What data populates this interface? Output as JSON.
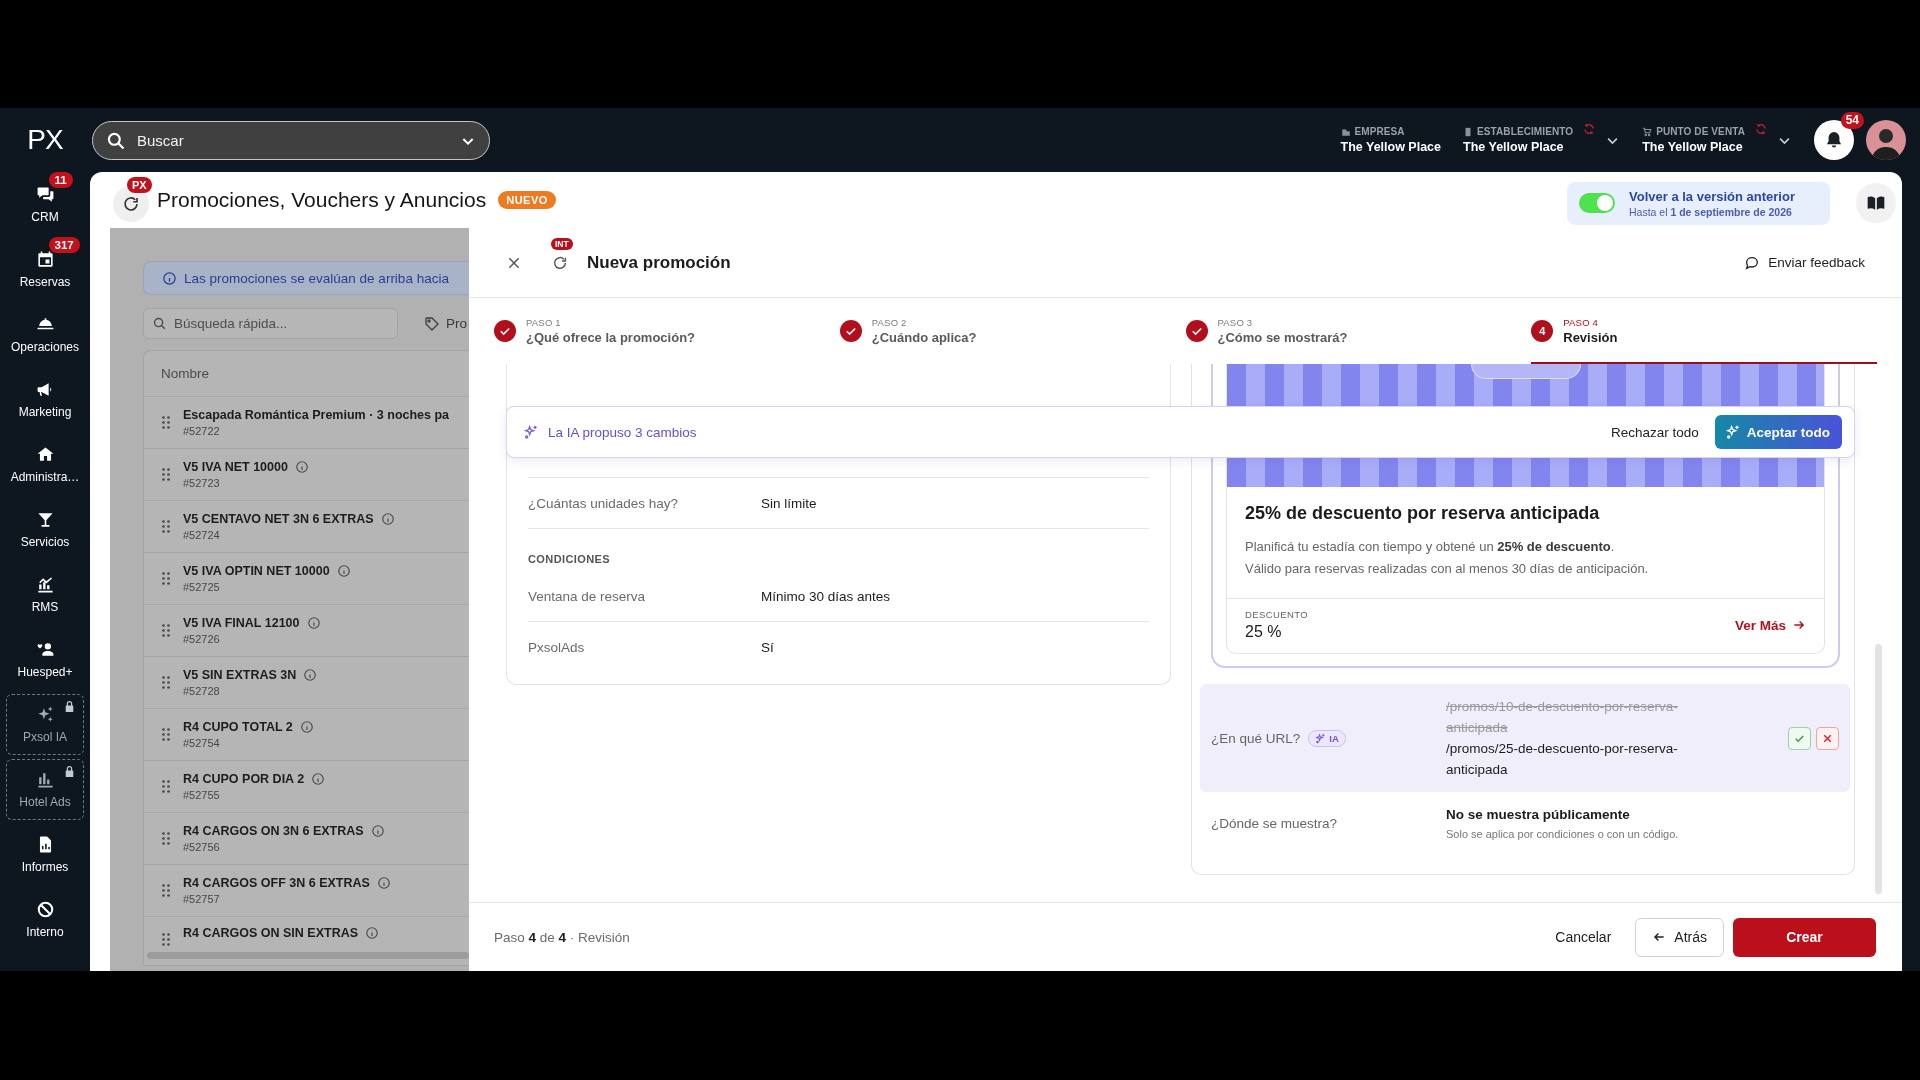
{
  "topbar": {
    "logo": "PX",
    "search": {
      "placeholder": "Buscar"
    },
    "context": [
      {
        "kind": "company",
        "label": "EMPRESA",
        "value": "The Yellow Place",
        "sync": false,
        "dropdown": false
      },
      {
        "kind": "property",
        "label": "ESTABLECIMIENTO",
        "value": "The Yellow Place",
        "sync": true,
        "dropdown": true
      },
      {
        "kind": "pos",
        "label": "PUNTO DE VENTA",
        "value": "The Yellow Place",
        "sync": true,
        "dropdown": true
      }
    ],
    "notifications": {
      "count": "54"
    }
  },
  "sidebar": {
    "items": [
      {
        "label": "CRM",
        "badge": "11",
        "locked": false,
        "selected": false
      },
      {
        "label": "Reservas",
        "badge": "317",
        "locked": false,
        "selected": false
      },
      {
        "label": "Operaciones",
        "locked": false,
        "selected": false
      },
      {
        "label": "Marketing",
        "locked": false,
        "selected": false
      },
      {
        "label": "Administra…",
        "locked": false,
        "selected": false
      },
      {
        "label": "Servicios",
        "locked": false,
        "selected": false
      },
      {
        "label": "RMS",
        "locked": false,
        "selected": false
      },
      {
        "label": "Huesped+",
        "locked": false,
        "selected": false
      },
      {
        "label": "Pxsol IA",
        "locked": true,
        "selected": false
      },
      {
        "label": "Hotel Ads",
        "locked": true,
        "selected": false
      },
      {
        "label": "Informes",
        "locked": false,
        "selected": false
      },
      {
        "label": "Interno",
        "locked": false,
        "selected": false
      }
    ]
  },
  "page": {
    "title": "Promociones, Vouchers y Anuncios",
    "badge": "NUEVO",
    "refresh_badge": "PX",
    "legacy": {
      "on": true,
      "title": "Volver a la versión anterior",
      "subtitle": "Hasta el **1 de septiembre de 2026**"
    }
  },
  "list": {
    "notice": "Las promociones se evalúan de arriba hacia",
    "search": {
      "placeholder": "Búsqueda rápida..."
    },
    "filter": "Pro",
    "columns": [
      "Nombre"
    ],
    "rows": [
      {
        "name": "Escapada Romántica Premium · 3 noches pa",
        "id": "#52722",
        "info": false
      },
      {
        "name": "V5 IVA NET 10000",
        "id": "#52723",
        "info": true
      },
      {
        "name": "V5 CENTAVO NET 3N 6 EXTRAS",
        "id": "#52724",
        "info": true
      },
      {
        "name": "V5 IVA OPTIN NET 10000",
        "id": "#52725",
        "info": true
      },
      {
        "name": "V5 IVA FINAL 12100",
        "id": "#52726",
        "info": true
      },
      {
        "name": "V5 SIN EXTRAS 3N",
        "id": "#52728",
        "info": true
      },
      {
        "name": "R4 CUPO TOTAL 2",
        "id": "#52754",
        "info": true
      },
      {
        "name": "R4 CUPO POR DIA 2",
        "id": "#52755",
        "info": true
      },
      {
        "name": "R4 CARGOS ON 3N 6 EXTRAS",
        "id": "#52756",
        "info": true
      },
      {
        "name": "R4 CARGOS OFF 3N 6 EXTRAS",
        "id": "#52757",
        "info": true
      },
      {
        "name": "R4 CARGOS ON SIN EXTRAS",
        "info": true
      }
    ]
  },
  "drawer": {
    "title": "Nueva promoción",
    "title_badge": "INT",
    "feedback": "Enviar feedback",
    "steps": [
      {
        "label": "PASO 1",
        "title": "¿Qué ofrece la promoción?",
        "done": true,
        "selected": false
      },
      {
        "label": "PASO 2",
        "title": "¿Cuándo aplica?",
        "done": true,
        "selected": false
      },
      {
        "label": "PASO 3",
        "title": "¿Cómo se mostrará?",
        "done": true,
        "selected": false
      },
      {
        "label": "PASO 4",
        "number": "4",
        "title": "Revisión",
        "done": false,
        "selected": true
      }
    ],
    "ai_bar": {
      "message": "La IA propuso 3 cambios",
      "reject": "Rechazar todo",
      "accept": "Aceptar todo"
    },
    "summary": [
      {
        "rows": [
          {
            "label": "¿Cuántas unidades hay?",
            "value": "Sin límite"
          }
        ]
      },
      {
        "heading": "CONDICIONES",
        "rows": [
          {
            "label": "Ventana de reserva",
            "value": "Mínimo 30 días antes"
          },
          {
            "label": "PxsolAds",
            "value": "Sí"
          }
        ]
      }
    ],
    "preview": {
      "title": "25% de descuento por reserva anticipada",
      "description": [
        "Planificá tu estadía con tiempo y obtené un **25% de descuento**.",
        "Válido para reservas realizadas con al menos 30 días de anticipación."
      ],
      "stat_label": "DESCUENTO",
      "stat_value": "25 %",
      "link": "Ver Más"
    },
    "fields": [
      {
        "label": "¿En qué URL?",
        "ai_badge": "IA",
        "changed": true,
        "old_value": "/promos/10-de-descuento-por-reserva-anticipada",
        "value": "/promos/25-de-descuento-por-reserva-anticipada"
      },
      {
        "label": "¿Dónde se muestra?",
        "changed": false,
        "value": "No se muestra públicamente",
        "note": "Solo se aplica por condiciones o con un código."
      }
    ],
    "footer": {
      "caption": "Paso **4** de **4** · Revisión",
      "cancel": "Cancelar",
      "back": "Atrás",
      "create": "Crear"
    }
  }
}
